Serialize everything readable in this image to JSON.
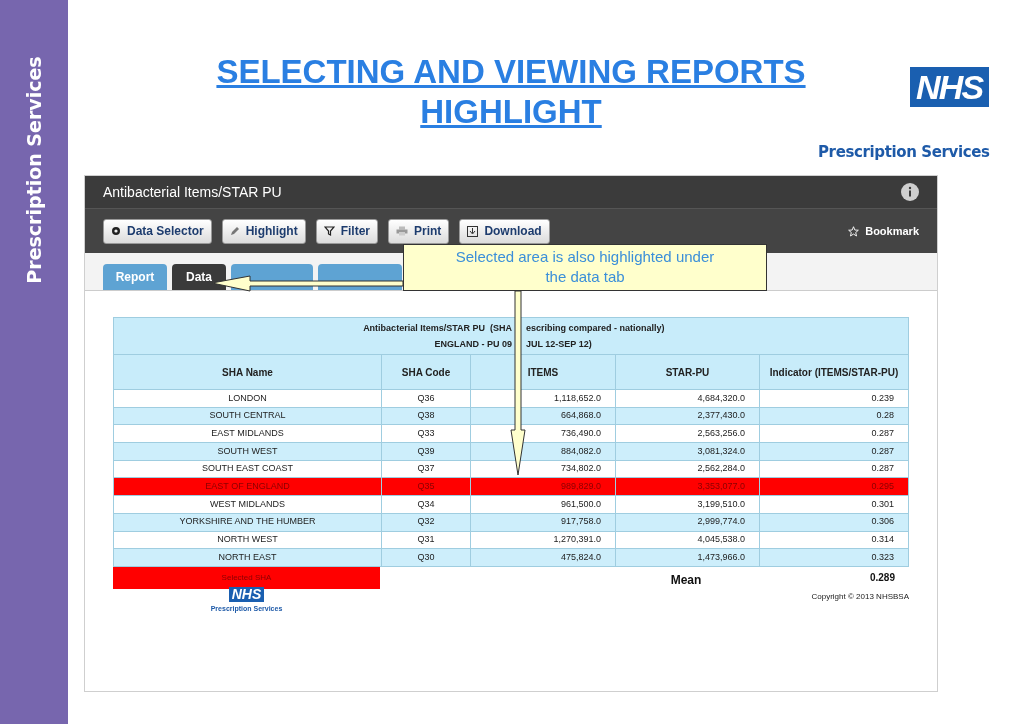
{
  "sidebar_label": "Prescription Services",
  "title": "SELECTING AND VIEWING REPORTS HIGHLIGHT",
  "logo": {
    "mark": "NHS",
    "subtitle": "Prescription Services"
  },
  "app": {
    "title": "Antibacterial Items/STAR PU",
    "toolbar": [
      {
        "label": "Data Selector"
      },
      {
        "label": "Highlight"
      },
      {
        "label": "Filter"
      },
      {
        "label": "Print"
      },
      {
        "label": "Download"
      }
    ],
    "bookmark": "Bookmark",
    "tabs": [
      {
        "label": "Report",
        "selected": false
      },
      {
        "label": "Data",
        "selected": true
      },
      {
        "selected": false
      },
      {
        "selected": false
      }
    ],
    "table": {
      "title_lines": [
        [
          "Antibacterial Items/STAR PU  (SHA",
          "escribing compared - nationally)"
        ],
        [
          "ENGLAND - PU 09",
          "JUL 12-SEP 12)"
        ]
      ],
      "columns": [
        "SHA Name",
        "SHA Code",
        "ITEMS",
        "STAR-PU",
        "Indicator (ITEMS/STAR-PU)"
      ],
      "rows": [
        {
          "cells": [
            "LONDON",
            "Q36",
            "1,118,652.0",
            "4,684,320.0",
            "0.239"
          ],
          "selected": false
        },
        {
          "cells": [
            "SOUTH CENTRAL",
            "Q38",
            "664,868.0",
            "2,377,430.0",
            "0.28"
          ],
          "selected": false
        },
        {
          "cells": [
            "EAST MIDLANDS",
            "Q33",
            "736,490.0",
            "2,563,256.0",
            "0.287"
          ],
          "selected": false
        },
        {
          "cells": [
            "SOUTH WEST",
            "Q39",
            "884,082.0",
            "3,081,324.0",
            "0.287"
          ],
          "selected": false
        },
        {
          "cells": [
            "SOUTH EAST COAST",
            "Q37",
            "734,802.0",
            "2,562,284.0",
            "0.287"
          ],
          "selected": false
        },
        {
          "cells": [
            "EAST OF ENGLAND",
            "Q35",
            "989,829.0",
            "3,353,077.0",
            "0.295"
          ],
          "selected": true
        },
        {
          "cells": [
            "WEST MIDLANDS",
            "Q34",
            "961,500.0",
            "3,199,510.0",
            "0.301"
          ],
          "selected": false
        },
        {
          "cells": [
            "YORKSHIRE AND THE HUMBER",
            "Q32",
            "917,758.0",
            "2,999,774.0",
            "0.306"
          ],
          "selected": false
        },
        {
          "cells": [
            "NORTH WEST",
            "Q31",
            "1,270,391.0",
            "4,045,538.0",
            "0.314"
          ],
          "selected": false
        },
        {
          "cells": [
            "NORTH EAST",
            "Q30",
            "475,824.0",
            "1,473,966.0",
            "0.323"
          ],
          "selected": false
        }
      ],
      "legend": "Selected SHA",
      "mean_label": "Mean",
      "mean_value": "0.289"
    },
    "footer_logo": {
      "mark": "NHS",
      "subtitle": "Prescription Services"
    },
    "copyright": "Copyright © 2013 NHSBSA"
  },
  "callout": "Selected area is also highlighted under the data tab"
}
